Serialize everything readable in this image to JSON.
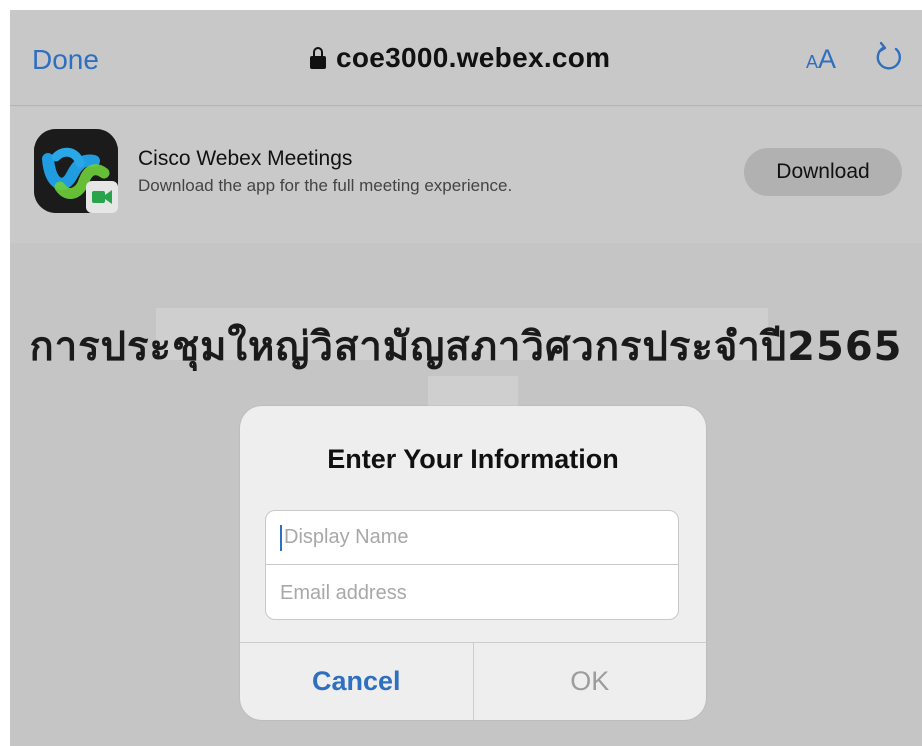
{
  "topbar": {
    "done_label": "Done",
    "url": "coe3000.webex.com",
    "text_size_small": "A",
    "text_size_large": "A",
    "lock_icon": "lock-icon",
    "reload_icon": "reload-icon"
  },
  "app_banner": {
    "app_name": "Cisco Webex Meetings",
    "app_subtitle": "Download the app for the full meeting experience.",
    "download_label": "Download",
    "app_icon": "webex-app-icon"
  },
  "page": {
    "meeting_title": "การประชุมใหญ่วิสามัญสภาวิศวกรประจำปี2565"
  },
  "dialog": {
    "title": "Enter Your Information",
    "display_name_placeholder": "Display Name",
    "email_placeholder": "Email address",
    "cancel_label": "Cancel",
    "ok_label": "OK"
  },
  "colors": {
    "accent": "#2f6fc0",
    "background": "#c6c6c6",
    "dialog_bg": "#eeeeee"
  }
}
